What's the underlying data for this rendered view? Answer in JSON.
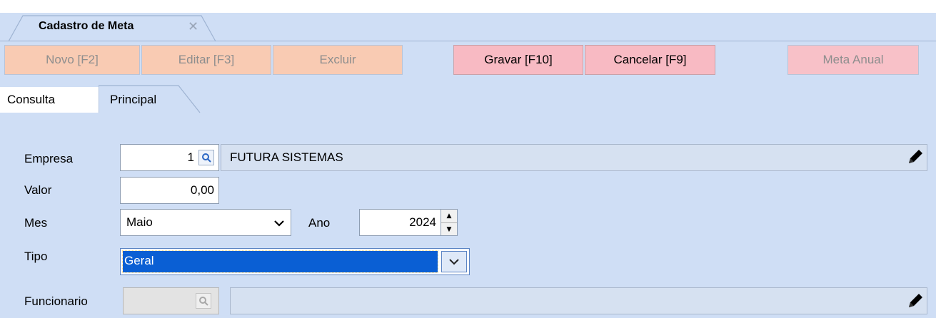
{
  "document_tab": {
    "title": "Cadastro de Meta",
    "close_glyph": "✕"
  },
  "toolbar": {
    "novo": "Novo [F2]",
    "editar": "Editar [F3]",
    "excluir": "Excluir",
    "gravar": "Gravar [F10]",
    "cancelar": "Cancelar [F9]",
    "meta_anual": "Meta Anual"
  },
  "page_tabs": {
    "consulta": "Consulta",
    "principal": "Principal",
    "active": "Principal"
  },
  "form": {
    "empresa": {
      "label": "Empresa",
      "code": "1",
      "name": "FUTURA SISTEMAS"
    },
    "valor": {
      "label": "Valor",
      "value": "0,00"
    },
    "mes": {
      "label": "Mes",
      "value": "Maio"
    },
    "ano": {
      "label": "Ano",
      "value": "2024"
    },
    "tipo": {
      "label": "Tipo",
      "value": "Geral"
    },
    "funcionario": {
      "label": "Funcionario",
      "code": "",
      "name": ""
    }
  },
  "icons": {
    "lookup": "magnifier-icon",
    "edit": "pencil-icon",
    "dropdown": "chevron-down-icon",
    "spin": "spin-up-down-icon",
    "close": "close-icon"
  },
  "colors": {
    "background": "#cfdef5",
    "disabled_button": "#f9cbb3",
    "active_button": "#f8bac3",
    "selection": "#0a5fd4"
  }
}
